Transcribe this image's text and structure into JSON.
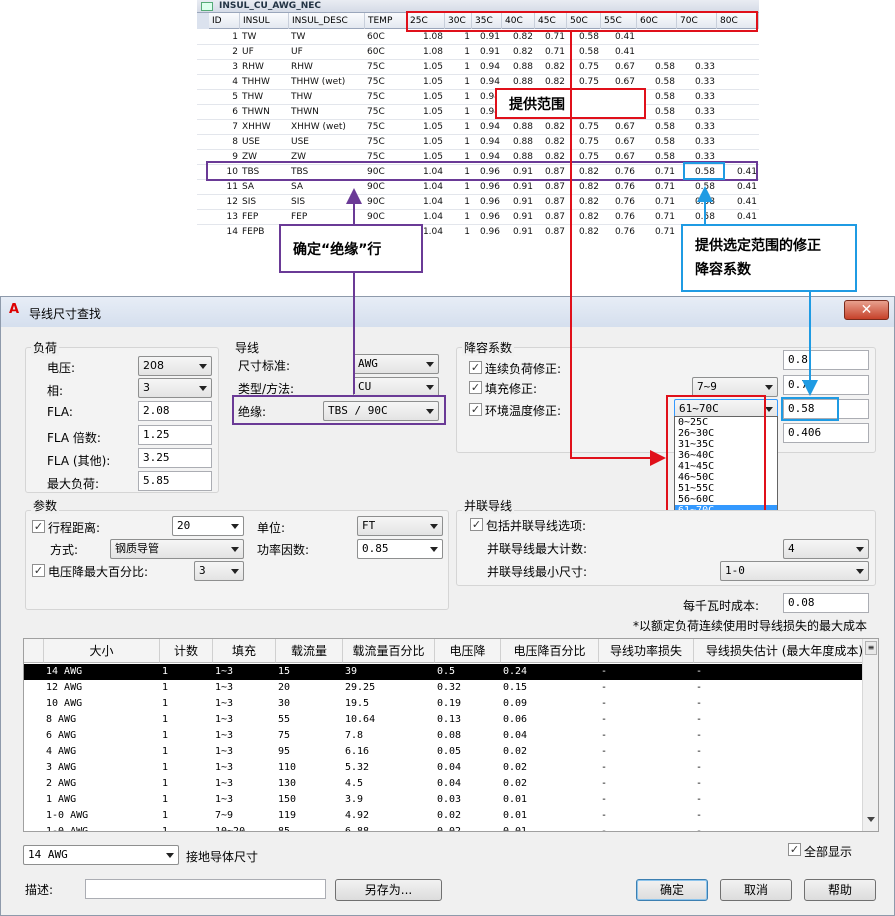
{
  "table": {
    "caption": "INSUL_CU_AWG_NEC",
    "headers": [
      "ID",
      "INSUL",
      "INSUL_DESC",
      "TEMP",
      "25C",
      "30C",
      "35C",
      "40C",
      "45C",
      "50C",
      "55C",
      "60C",
      "70C",
      "80C"
    ],
    "rows": [
      [
        "1",
        "TW",
        "TW",
        "60C",
        "1.08",
        "1",
        "0.91",
        "0.82",
        "0.71",
        "0.58",
        "0.41",
        "",
        "",
        ""
      ],
      [
        "2",
        "UF",
        "UF",
        "60C",
        "1.08",
        "1",
        "0.91",
        "0.82",
        "0.71",
        "0.58",
        "0.41",
        "",
        "",
        ""
      ],
      [
        "3",
        "RHW",
        "RHW",
        "75C",
        "1.05",
        "1",
        "0.94",
        "0.88",
        "0.82",
        "0.75",
        "0.67",
        "0.58",
        "0.33",
        ""
      ],
      [
        "4",
        "THHW",
        "THHW (wet)",
        "75C",
        "1.05",
        "1",
        "0.94",
        "0.88",
        "0.82",
        "0.75",
        "0.67",
        "0.58",
        "0.33",
        ""
      ],
      [
        "5",
        "THW",
        "THW",
        "75C",
        "1.05",
        "1",
        "0.94",
        "0.88",
        "0.82",
        "0.75",
        "0.67",
        "0.58",
        "0.33",
        ""
      ],
      [
        "6",
        "THWN",
        "THWN",
        "75C",
        "1.05",
        "1",
        "0.94",
        "0.88",
        "0.82",
        "0.75",
        "0.67",
        "0.58",
        "0.33",
        ""
      ],
      [
        "7",
        "XHHW",
        "XHHW (wet)",
        "75C",
        "1.05",
        "1",
        "0.94",
        "0.88",
        "0.82",
        "0.75",
        "0.67",
        "0.58",
        "0.33",
        ""
      ],
      [
        "8",
        "USE",
        "USE",
        "75C",
        "1.05",
        "1",
        "0.94",
        "0.88",
        "0.82",
        "0.75",
        "0.67",
        "0.58",
        "0.33",
        ""
      ],
      [
        "9",
        "ZW",
        "ZW",
        "75C",
        "1.05",
        "1",
        "0.94",
        "0.88",
        "0.82",
        "0.75",
        "0.67",
        "0.58",
        "0.33",
        ""
      ],
      [
        "10",
        "TBS",
        "TBS",
        "90C",
        "1.04",
        "1",
        "0.96",
        "0.91",
        "0.87",
        "0.82",
        "0.76",
        "0.71",
        "0.58",
        "0.41"
      ],
      [
        "11",
        "SA",
        "SA",
        "90C",
        "1.04",
        "1",
        "0.96",
        "0.91",
        "0.87",
        "0.82",
        "0.76",
        "0.71",
        "0.58",
        "0.41"
      ],
      [
        "12",
        "SIS",
        "SIS",
        "90C",
        "1.04",
        "1",
        "0.96",
        "0.91",
        "0.87",
        "0.82",
        "0.76",
        "0.71",
        "0.58",
        "0.41"
      ],
      [
        "13",
        "FEP",
        "FEP",
        "90C",
        "1.04",
        "1",
        "0.96",
        "0.91",
        "0.87",
        "0.82",
        "0.76",
        "0.71",
        "0.58",
        "0.41"
      ],
      [
        "14",
        "FEPB",
        "FEPB",
        "90C",
        "1.04",
        "1",
        "0.96",
        "0.91",
        "0.87",
        "0.82",
        "0.76",
        "0.71",
        "0.58",
        "0.41"
      ]
    ]
  },
  "notes": {
    "range": "提供范围",
    "insul_row": "确定“绝缘”行",
    "factor_line1": "提供选定范围的修正",
    "factor_line2": "降容系数"
  },
  "colors": {
    "red": "#e0101a",
    "purple": "#6a3a96",
    "blue": "#1f9be3"
  },
  "dialog": {
    "title": "导线尺寸查找",
    "load": {
      "title": "负荷",
      "voltage_label": "电压:",
      "voltage": "208",
      "phase_label": "相:",
      "phase": "3",
      "fla_label": "FLA:",
      "fla": "2.08",
      "fla_mult_label": "FLA 倍数:",
      "fla_mult": "1.25",
      "fla_other_label": "FLA (其他):",
      "fla_other": "3.25",
      "max_load_label": "最大负荷:",
      "max_load": "5.85"
    },
    "wire": {
      "title": "导线",
      "size_std_label": "尺寸标准:",
      "size_std": "AWG",
      "type_label": "类型/方法:",
      "type": "CU",
      "insul_label": "绝缘:",
      "insul": "TBS / 90C"
    },
    "derate": {
      "title": "降容系数",
      "cont_label": "连续负荷修正:",
      "cont_value": "0.8",
      "fill_label": "填充修正:",
      "fill_combo": "7~9",
      "fill_value": "0.7",
      "temp_label": "环境温度修正:",
      "temp_combo": "61~70C",
      "temp_value": "0.58",
      "total_value": "0.406",
      "options": [
        "0~25C",
        "26~30C",
        "31~35C",
        "36~40C",
        "41~45C",
        "46~50C",
        "51~55C",
        "56~60C",
        "61~70C",
        "71~80C"
      ],
      "selected_index": 8
    },
    "params": {
      "title": "参数",
      "distance_label": "行程距离:",
      "distance": "20",
      "unit_label": "单位:",
      "unit": "FT",
      "method_label": "方式:",
      "method": "钢质导管",
      "pf_label": "功率因数:",
      "pf": "0.85",
      "vdrop_label": "电压降最大百分比:",
      "vdrop": "3"
    },
    "parallel": {
      "title": "并联导线",
      "include_label": "包括并联导线选项:",
      "max_count_label": "并联导线最大计数:",
      "max_count": "4",
      "min_size_label": "并联导线最小尺寸:",
      "min_size": "1-0"
    },
    "cost_label": "每千瓦时成本:",
    "cost": "0.08",
    "cost_note": "*以额定负荷连续使用时导线损失的最大成本",
    "grid": {
      "headers": [
        "大小",
        "计数",
        "填充",
        "载流量",
        "载流量百分比",
        "电压降",
        "电压降百分比",
        "导线功率损失",
        "导线损失估计 (最大年度成本)*"
      ],
      "rows": [
        [
          "14 AWG",
          "1",
          "1~3",
          "15",
          "39",
          "0.5",
          "0.24",
          "-",
          "-"
        ],
        [
          "12 AWG",
          "1",
          "1~3",
          "20",
          "29.25",
          "0.32",
          "0.15",
          "-",
          "-"
        ],
        [
          "10 AWG",
          "1",
          "1~3",
          "30",
          "19.5",
          "0.19",
          "0.09",
          "-",
          "-"
        ],
        [
          "8 AWG",
          "1",
          "1~3",
          "55",
          "10.64",
          "0.13",
          "0.06",
          "-",
          "-"
        ],
        [
          "6 AWG",
          "1",
          "1~3",
          "75",
          "7.8",
          "0.08",
          "0.04",
          "-",
          "-"
        ],
        [
          "4 AWG",
          "1",
          "1~3",
          "95",
          "6.16",
          "0.05",
          "0.02",
          "-",
          "-"
        ],
        [
          "3 AWG",
          "1",
          "1~3",
          "110",
          "5.32",
          "0.04",
          "0.02",
          "-",
          "-"
        ],
        [
          "2 AWG",
          "1",
          "1~3",
          "130",
          "4.5",
          "0.04",
          "0.02",
          "-",
          "-"
        ],
        [
          "1 AWG",
          "1",
          "1~3",
          "150",
          "3.9",
          "0.03",
          "0.01",
          "-",
          "-"
        ],
        [
          "1-0 AWG",
          "1",
          "7~9",
          "119",
          "4.92",
          "0.02",
          "0.01",
          "-",
          "-"
        ],
        [
          "1-0 AWG",
          "1",
          "10~20",
          "85",
          "6.88",
          "0.02",
          "0.01",
          "-",
          "-"
        ]
      ]
    },
    "ground_size": "14 AWG",
    "ground_label": "接地导体尺寸",
    "show_all_label": "全部显示",
    "desc_label": "描述:",
    "save_as": "另存为...",
    "ok": "确定",
    "cancel": "取消",
    "help": "帮助"
  }
}
